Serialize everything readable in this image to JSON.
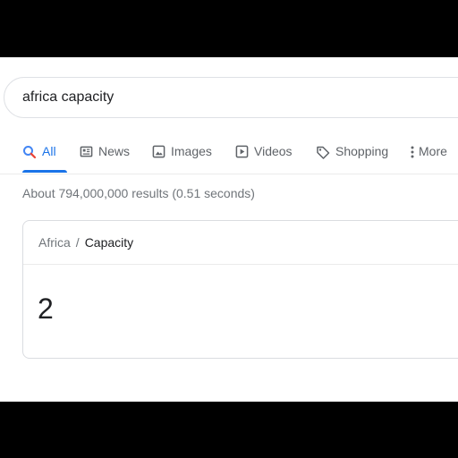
{
  "search": {
    "query": "africa capacity"
  },
  "tabs": [
    {
      "label": "All",
      "icon": "search-icon",
      "active": true
    },
    {
      "label": "News",
      "icon": "news-icon"
    },
    {
      "label": "Images",
      "icon": "image-icon"
    },
    {
      "label": "Videos",
      "icon": "play-icon"
    },
    {
      "label": "Shopping",
      "icon": "tag-icon"
    },
    {
      "label": "More",
      "icon": "more-vert-icon"
    }
  ],
  "result_stats": "About 794,000,000 results (0.51 seconds)",
  "answer_card": {
    "breadcrumb_parent": "Africa",
    "breadcrumb_separator": "/",
    "breadcrumb_current": "Capacity",
    "value": "2"
  },
  "colors": {
    "accent": "#1a73e8",
    "text": "#202124",
    "secondary_text": "#70757a",
    "border": "#dadce0",
    "letterbox": "#000000"
  }
}
